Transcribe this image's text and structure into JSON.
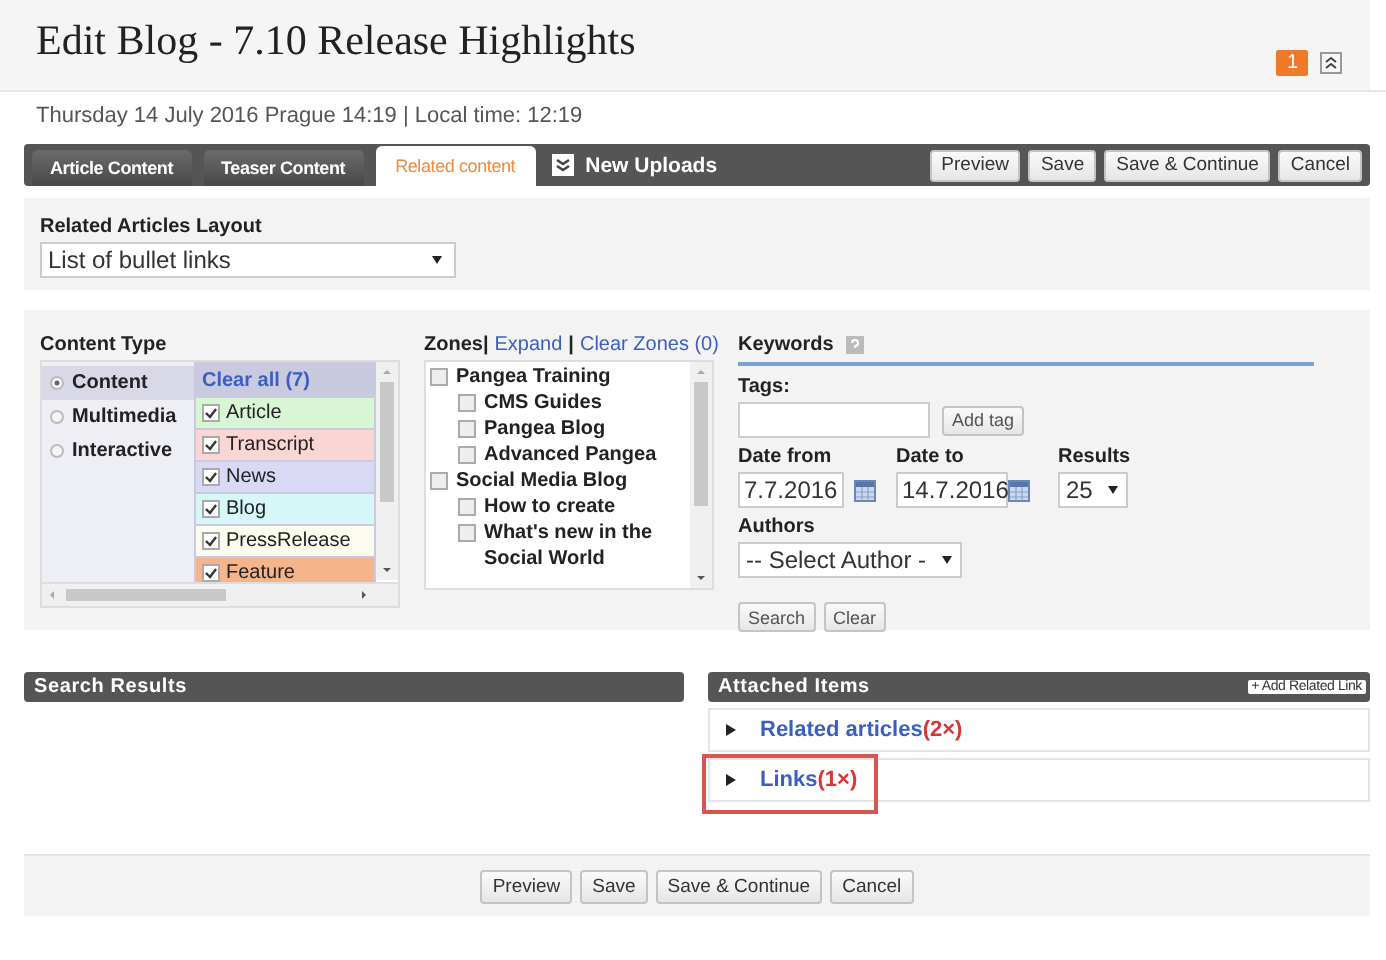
{
  "page": {
    "title": "Edit Blog - 7.10 Release Highlights",
    "notification_count": "1",
    "date_line": "Thursday 14 July 2016 Prague 14:19 | Local time: 12:19"
  },
  "tabs": [
    {
      "label": "Article Content",
      "selected": false
    },
    {
      "label": "Teaser Content",
      "selected": false
    },
    {
      "label": "Related content",
      "selected": true
    }
  ],
  "new_uploads": "New Uploads",
  "toolbar_buttons": [
    "Preview",
    "Save",
    "Save & Continue",
    "Cancel"
  ],
  "layout": {
    "label": "Related Articles Layout",
    "value": "List of bullet links"
  },
  "content_type": {
    "label": "Content Type",
    "groups": [
      {
        "label": "Content",
        "selected": true
      },
      {
        "label": "Multimedia",
        "selected": false
      },
      {
        "label": "Interactive",
        "selected": false
      }
    ],
    "clear_all": "Clear all (7)",
    "types": [
      {
        "label": "Article",
        "checked": true,
        "color": "#d8f5d4"
      },
      {
        "label": "Transcript",
        "checked": true,
        "color": "#f9d6d4"
      },
      {
        "label": "News",
        "checked": true,
        "color": "#d9d9f5"
      },
      {
        "label": "Blog",
        "checked": true,
        "color": "#d6f6f8"
      },
      {
        "label": "PressRelease",
        "checked": true,
        "color": "#fbfbef"
      },
      {
        "label": "Feature",
        "checked": true,
        "color": "#f6b48a"
      }
    ]
  },
  "zones": {
    "label": "Zones|",
    "expand": "Expand",
    "separator": "|",
    "clear": "Clear Zones (0)",
    "items": [
      {
        "label": "Pangea Training",
        "checked": false,
        "children": [
          {
            "label": "CMS Guides",
            "checked": false
          },
          {
            "label": "Pangea Blog",
            "checked": false
          },
          {
            "label": "Advanced Pangea",
            "checked": false
          }
        ]
      },
      {
        "label": "Social Media Blog",
        "checked": false,
        "children": [
          {
            "label": "How to create",
            "checked": false
          },
          {
            "label": "What's new in the Social World",
            "checked": false
          }
        ]
      }
    ]
  },
  "search_form": {
    "keywords_label": "Keywords",
    "tags_label": "Tags:",
    "add_tag": "Add tag",
    "date_from_label": "Date from",
    "date_from": "7.7.2016",
    "date_to_label": "Date to",
    "date_to": "14.7.2016",
    "results_label": "Results",
    "results": "25",
    "authors_label": "Authors",
    "authors": "-- Select Author -",
    "search": "Search",
    "clear": "Clear"
  },
  "search_results": {
    "title": "Search Results"
  },
  "attached": {
    "title": "Attached Items",
    "add": "+ Add Related Link",
    "items": [
      {
        "label": "Related articles",
        "count": "(2×)",
        "highlighted": false
      },
      {
        "label": "Links",
        "count": "(1×)",
        "highlighted": true
      }
    ]
  },
  "footer_buttons": [
    "Preview",
    "Save",
    "Save & Continue",
    "Cancel"
  ]
}
